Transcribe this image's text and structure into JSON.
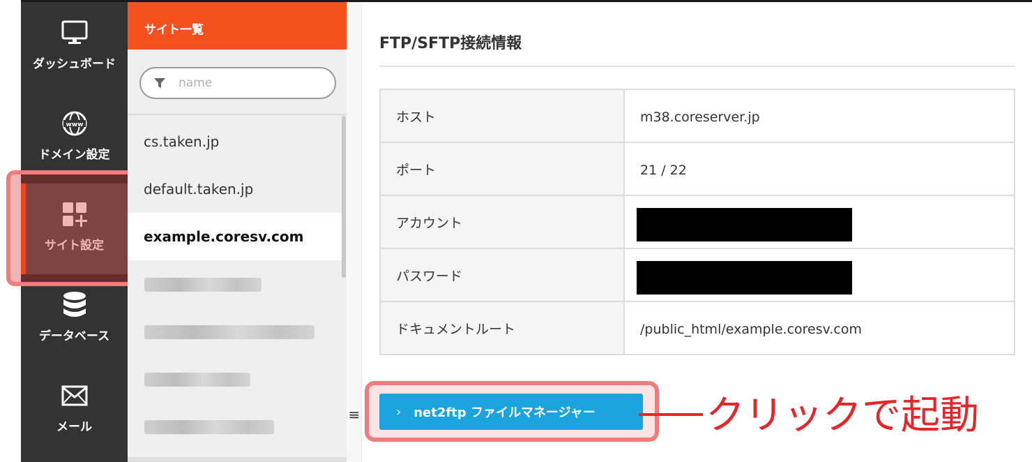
{
  "nav": {
    "items": [
      {
        "label": "ダッシュボード",
        "icon": "monitor-icon"
      },
      {
        "label": "ドメイン設定",
        "icon": "globe-www-icon"
      },
      {
        "label": "サイト設定",
        "icon": "apps-add-icon"
      },
      {
        "label": "データベース",
        "icon": "database-icon"
      },
      {
        "label": "メール",
        "icon": "mail-icon"
      }
    ],
    "active_index": 2
  },
  "site_panel": {
    "header": "サイト一覧",
    "filter_placeholder": "name",
    "items": [
      "cs.taken.jp",
      "default.taken.jp",
      "example.coresv.com"
    ],
    "selected_index": 2
  },
  "main": {
    "title": "FTP/SFTP接続情報",
    "rows": [
      {
        "label": "ホスト",
        "value": "m38.coreserver.jp"
      },
      {
        "label": "ポート",
        "value": "21 / 22"
      },
      {
        "label": "アカウント",
        "value": ""
      },
      {
        "label": "パスワード",
        "value": ""
      },
      {
        "label": "ドキュメントルート",
        "value": "/public_html/example.coresv.com"
      }
    ],
    "button": {
      "chevron": "›",
      "label": "net2ftp ファイルマネージャー"
    },
    "menu_toggle": "≡"
  },
  "annotation": {
    "callout": "クリックで起動"
  },
  "colors": {
    "nav_bg": "#333333",
    "accent_orange": "#f4511e",
    "button_blue": "#1aa3dc",
    "annotation_red": "#e4262b",
    "highlight_pink": "#f07c7c"
  }
}
